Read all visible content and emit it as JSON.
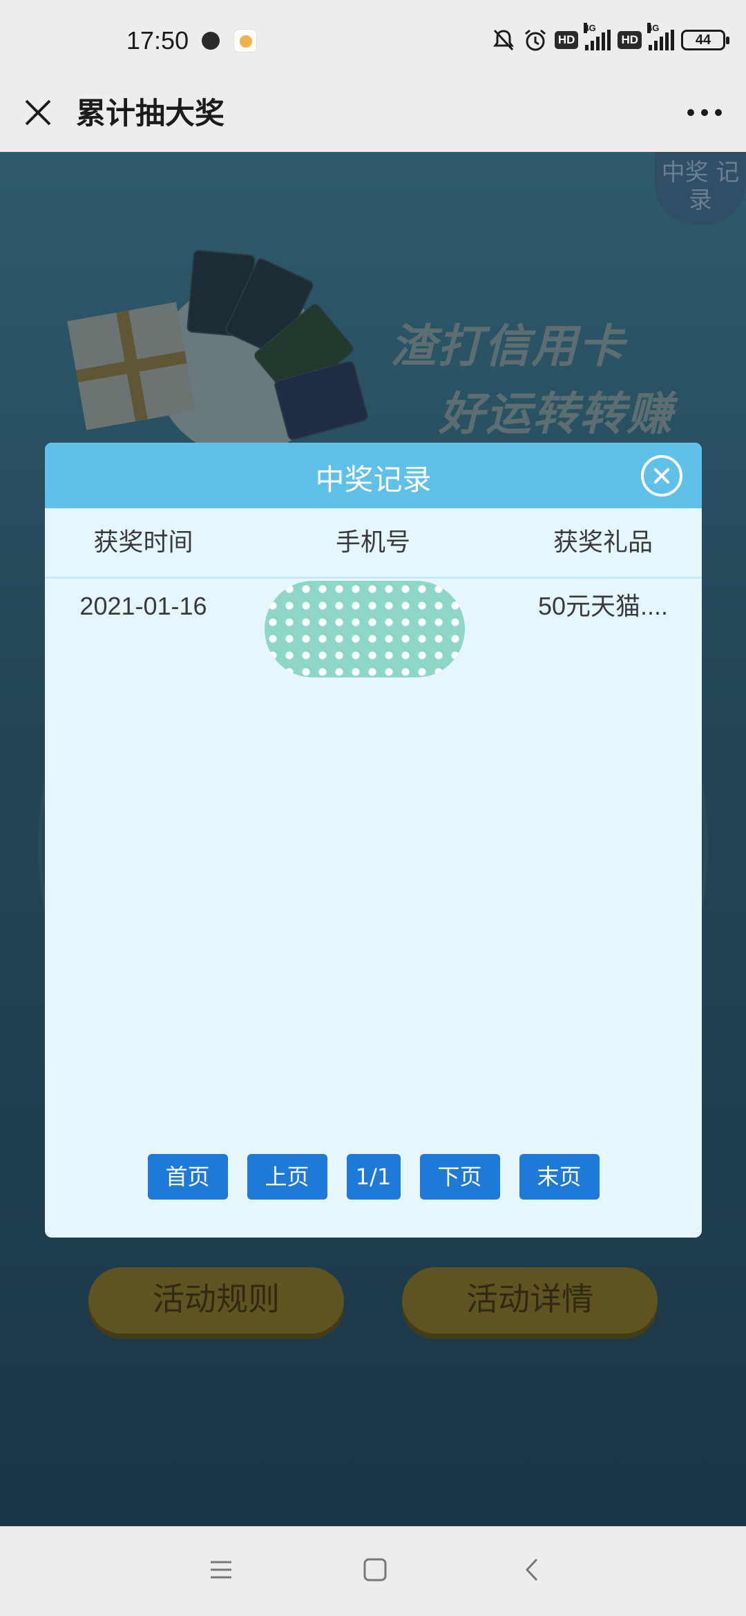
{
  "status_bar": {
    "time": "17:50",
    "hd1": "HD",
    "hd2": "HD",
    "net1": "4G",
    "net2": "4G",
    "battery": "44"
  },
  "title_bar": {
    "title": "累计抽大奖"
  },
  "background": {
    "record_corner": "中奖 记录",
    "headline_line1": "渣打信用卡",
    "headline_line2": "好运转转赚",
    "rules_button": "活动规则",
    "details_button": "活动详情"
  },
  "dialog": {
    "title": "中奖记录",
    "columns": [
      "获奖时间",
      "手机号",
      "获奖礼品"
    ],
    "rows": [
      {
        "time": "2021-01-16",
        "phone": "",
        "prize": "50元天猫...."
      }
    ],
    "pager": {
      "first": "首页",
      "prev": "上页",
      "page_indicator": "1/1",
      "next": "下页",
      "last": "末页"
    }
  },
  "colors": {
    "dialog_header": "#5fc0ea",
    "dialog_body": "#e6f6fd",
    "pager_button": "#1e7ad6"
  }
}
